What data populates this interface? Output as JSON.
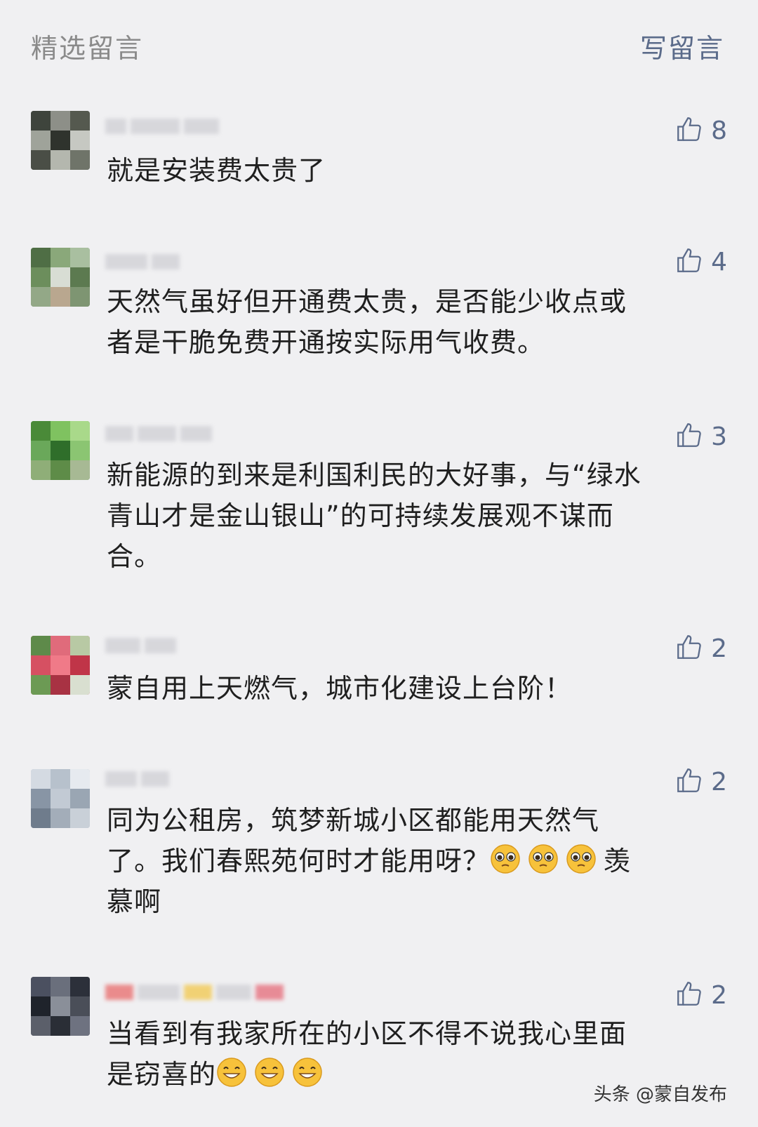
{
  "header": {
    "title": "精选留言",
    "write_label": "写留言"
  },
  "comments": [
    {
      "likes": "8",
      "text": "就是安装费太贵了"
    },
    {
      "likes": "4",
      "text": "天然气虽好但开通费太贵，是否能少收点或\n者是干脆免费开通按实际用气收费。"
    },
    {
      "likes": "3",
      "text": "新能源的到来是利国利民的大好事，与“绿水\n青山才是金山银山”的可持续发展观不谋而\n合。"
    },
    {
      "likes": "2",
      "text": "蒙自用上天燃气，城市化建设上台阶！"
    },
    {
      "likes": "2",
      "text_a": "同为公租房，筑梦新城小区都能用天然气\n了。我们春熙苑何时才能用呀？",
      "text_b": "羡\n慕啊"
    },
    {
      "likes": "2",
      "text_a": "当看到有我家所在的小区不得不说我心里面\n是窃喜的"
    }
  ],
  "watermark": "头条 @蒙自发布",
  "colors": {
    "background": "#f0f0f2",
    "accent": "#5b6b8a",
    "muted": "#8a8a8a"
  },
  "icons": {
    "like": "thumbs-up-icon",
    "emoji_pleading": "pleading-face-emoji-icon",
    "emoji_grin": "grinning-face-emoji-icon"
  }
}
